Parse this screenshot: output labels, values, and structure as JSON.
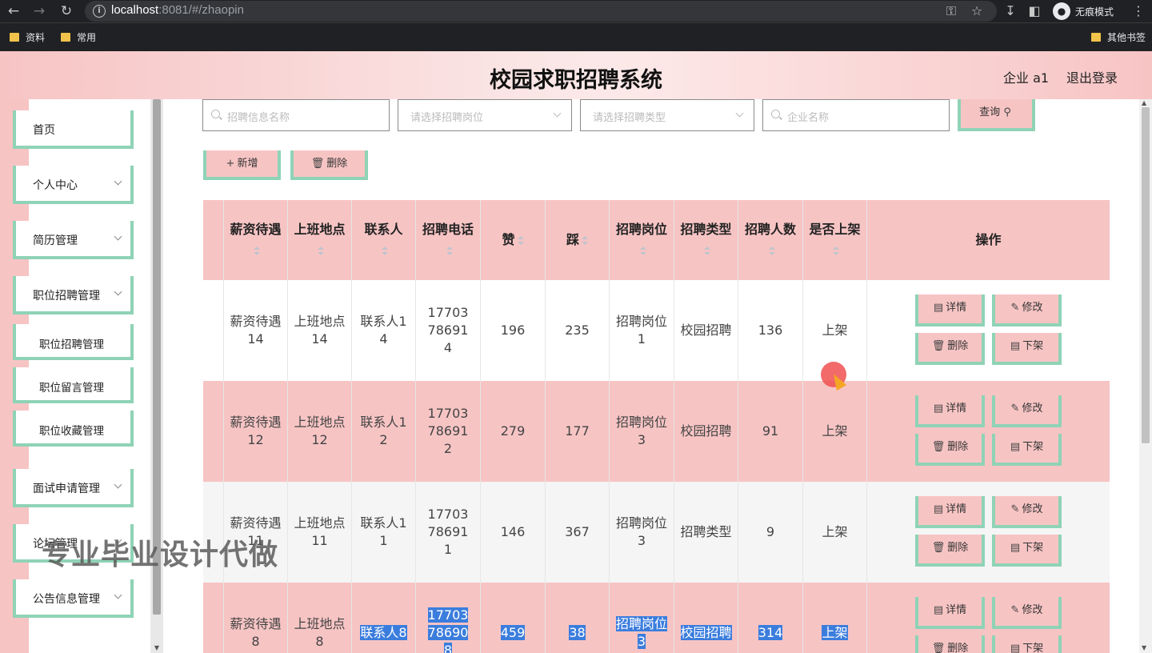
{
  "browser": {
    "url_host": "localhost",
    "url_path": ":8081/#/zhaopin",
    "incognito_label": "无痕模式",
    "bookmarks": [
      "资料",
      "常用"
    ],
    "other_bookmarks": "其他书签"
  },
  "header": {
    "title": "校园求职招聘系统",
    "user": "企业 a1",
    "logout": "退出登录"
  },
  "sidebar": {
    "items": [
      {
        "label": "首页"
      },
      {
        "label": "个人中心"
      },
      {
        "label": "简历管理"
      },
      {
        "label": "职位招聘管理"
      },
      {
        "label": "面试申请管理"
      },
      {
        "label": "论坛管理"
      },
      {
        "label": "公告信息管理"
      }
    ],
    "sub_items": [
      {
        "label": "职位招聘管理"
      },
      {
        "label": "职位留言管理"
      },
      {
        "label": "职位收藏管理"
      }
    ]
  },
  "search": {
    "name_placeholder": "招聘信息名称",
    "position_placeholder": "请选择招聘岗位",
    "type_placeholder": "请选择招聘类型",
    "company_placeholder": "企业名称",
    "query_label": "查询"
  },
  "toolbar": {
    "add_label": "新增",
    "delete_label": "删除"
  },
  "table": {
    "headers": [
      "薪资待遇",
      "上班地点",
      "联系人",
      "招聘电话",
      "赞",
      "踩",
      "招聘岗位",
      "招聘类型",
      "招聘人数",
      "是否上架",
      "操作"
    ],
    "rows": [
      {
        "salary": "薪资待遇14",
        "location": "上班地点14",
        "contact": "联系人14",
        "phone": "17703786914",
        "likes": "196",
        "dislikes": "235",
        "position": "招聘岗位1",
        "type": "校园招聘",
        "count": "136",
        "status": "上架"
      },
      {
        "salary": "薪资待遇12",
        "location": "上班地点12",
        "contact": "联系人12",
        "phone": "17703786912",
        "likes": "279",
        "dislikes": "177",
        "position": "招聘岗位3",
        "type": "校园招聘",
        "count": "91",
        "status": "上架"
      },
      {
        "salary": "薪资待遇11",
        "location": "上班地点11",
        "contact": "联系人11",
        "phone": "17703786911",
        "likes": "146",
        "dislikes": "367",
        "position": "招聘岗位3",
        "type": "招聘类型",
        "count": "9",
        "status": "上架"
      },
      {
        "salary": "薪资待遇8",
        "location": "上班地点8",
        "contact": "联系人8",
        "phone": "17703786908",
        "likes": "459",
        "dislikes": "38",
        "position": "招聘岗位3",
        "type": "校园招聘",
        "count": "314",
        "status": "上架"
      }
    ],
    "actions": {
      "detail": "详情",
      "edit": "修改",
      "delete": "删除",
      "offshelf": "下架"
    }
  },
  "watermark": "专业毕业设计代做",
  "colors": {
    "pink": "#f7c4c4",
    "green_border": "#8fd3b6",
    "selection": "#3b7ddd"
  }
}
